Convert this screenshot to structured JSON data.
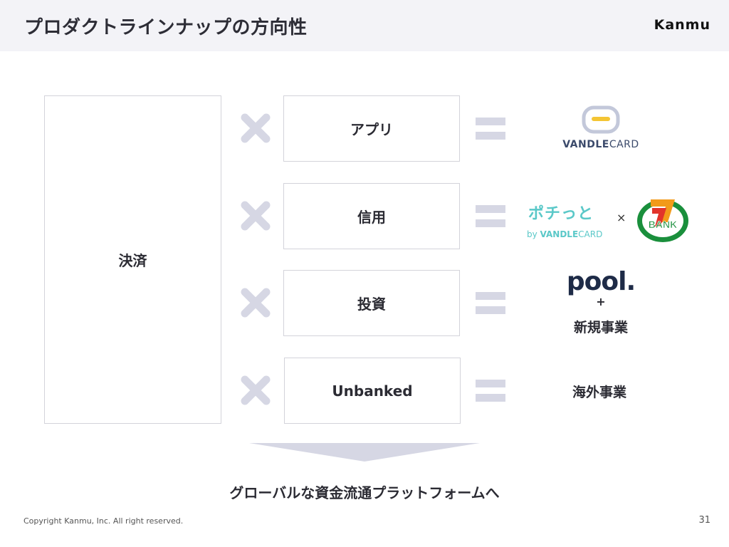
{
  "header": {
    "title": "プロダクトラインナップの方向性",
    "brand": "Kanmu"
  },
  "base": {
    "label": "決済"
  },
  "rows": [
    {
      "label": "アプリ"
    },
    {
      "label": "信用"
    },
    {
      "label": "投資"
    },
    {
      "label": "Unbanked"
    }
  ],
  "results": {
    "vandle": {
      "logo_text_1": "VANDLE",
      "logo_text_2": "CARD"
    },
    "pochitto": {
      "logo_text": "ポチっと",
      "byline_prefix": "by ",
      "byline_1": "VANDLE",
      "byline_2": "CARD",
      "times": "×"
    },
    "sevenbank": {
      "logo_text": "BANK"
    },
    "pool": {
      "logo_text": "pool.",
      "plus": "+",
      "text": "新規事業"
    },
    "overseas": {
      "text": "海外事業"
    }
  },
  "conclusion": "グローバルな資金流通プラットフォームへ",
  "footer": {
    "copyright": "Copyright Kanmu, Inc. All right reserved.",
    "page": "31"
  },
  "colors": {
    "accent_gray": "#d6d7e4",
    "vandle_blue": "#3b4a6b",
    "pochitto_teal": "#5ac8c8",
    "pool_navy": "#1e2b47",
    "pool_dot": "#2ab3e0",
    "seven_green": "#1a8f3c",
    "seven_red": "#e2342b",
    "seven_orange": "#f29a1a"
  }
}
